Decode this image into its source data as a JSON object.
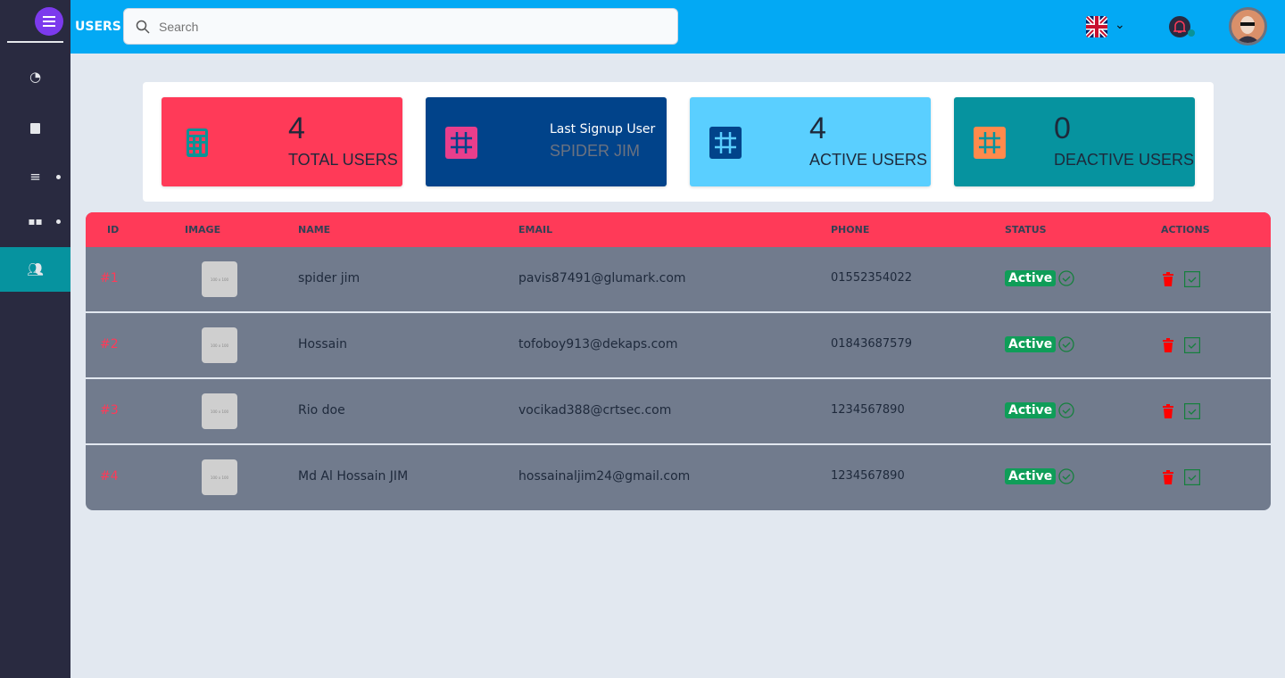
{
  "header": {
    "title": "USERS",
    "search_placeholder": "Search",
    "language": "en-GB"
  },
  "colors": {
    "topbar": "#03a9f4",
    "sidebar": "#292a40",
    "accent": "#ff3a58",
    "active_nav": "#06939f"
  },
  "sidebar": {
    "items": [
      {
        "icon": "dashboard-icon"
      },
      {
        "icon": "document-icon"
      },
      {
        "icon": "list-icon",
        "has_submenu": true
      },
      {
        "icon": "apps-icon",
        "has_submenu": true
      },
      {
        "icon": "users-icon",
        "active": true
      }
    ]
  },
  "stats": [
    {
      "value": "4",
      "label": "TOTAL USERS",
      "icon": "calculator-icon",
      "color": "#ff3a58"
    },
    {
      "title": "Last Signup User",
      "value": "SPIDER JIM",
      "icon": "hash-icon",
      "color": "#01438a"
    },
    {
      "value": "4",
      "label": "ACTIVE USERS",
      "icon": "hash-icon",
      "color": "#5acfff"
    },
    {
      "value": "0",
      "label": "DEACTIVE USERS",
      "icon": "hash-icon",
      "color": "#06939f"
    }
  ],
  "table": {
    "columns": [
      "ID",
      "IMAGE",
      "NAME",
      "EMAIL",
      "PHONE",
      "STATUS",
      "ACTIONS"
    ],
    "image_placeholder": "100 x 100",
    "rows": [
      {
        "id": "#1",
        "name": "spider jim",
        "email": "pavis87491@glumark.com",
        "phone": "01552354022",
        "status": "Active"
      },
      {
        "id": "#2",
        "name": "Hossain",
        "email": "tofoboy913@dekaps.com",
        "phone": "01843687579",
        "status": "Active"
      },
      {
        "id": "#3",
        "name": "Rio doe",
        "email": "vocikad388@crtsec.com",
        "phone": "1234567890",
        "status": "Active"
      },
      {
        "id": "#4",
        "name": "Md Al Hossain JIM",
        "email": "hossainaljim24@gmail.com",
        "phone": "1234567890",
        "status": "Active"
      }
    ]
  }
}
